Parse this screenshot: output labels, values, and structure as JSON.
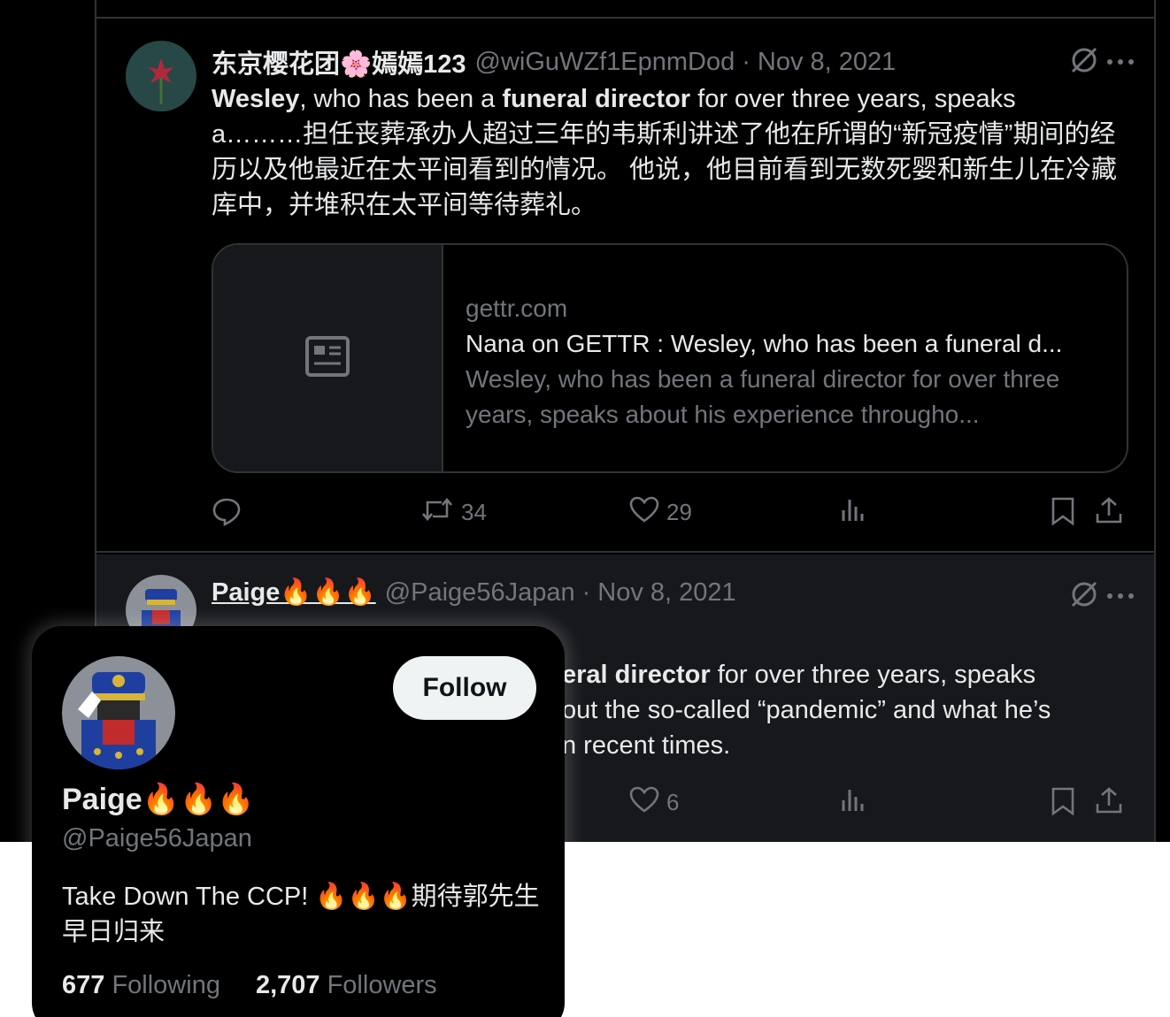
{
  "tweets": [
    {
      "display_name": "东京樱花团🌸嫣嫣123",
      "handle": "@wiGuWZf1EpnmDod",
      "separator": "·",
      "date": "Nov 8, 2021",
      "text_line1_a": "Wesley",
      "text_line1_b": ", who has been a ",
      "text_line1_c": "funeral director",
      "text_line1_d": " for over three years, speaks",
      "text_rest": "a………担任丧葬承办人超过三年的韦斯利讲述了他在所谓的“新冠疫情”期间的经历以及他最近在太平间看到的情况。 他说，他目前看到无数死婴和新生儿在冷藏库中，并堆积在太平间等待葬礼。",
      "card": {
        "domain": "gettr.com",
        "title": "Nana on GETTR : Wesley, who has been a funeral d...",
        "description": "Wesley, who has been a funeral director for over three years, speaks about his experience througho..."
      },
      "actions": {
        "replies": "",
        "reposts": "34",
        "likes": "29"
      }
    },
    {
      "display_name": "Paige🔥🔥🔥",
      "handle": "@Paige56Japan",
      "separator": "·",
      "date": "Nov 8, 2021",
      "text_line1_bold": "eral director",
      "text_line1_rest": " for over three years, speaks",
      "text_line2": "out the so-called “pandemic” and what he’s",
      "text_line3": "n recent times.",
      "actions": {
        "likes": "6"
      }
    }
  ],
  "hover_card": {
    "display_name": "Paige🔥🔥🔥",
    "handle": "@Paige56Japan",
    "follow_label": "Follow",
    "bio": "Take Down The CCP! 🔥🔥🔥期待郭先生早日归来",
    "following_count": "677",
    "following_label": "Following",
    "followers_count": "2,707",
    "followers_label": "Followers"
  },
  "icons": {
    "reply": "reply-icon",
    "repost": "repost-icon",
    "like": "heart-icon",
    "views": "views-icon",
    "bookmark": "bookmark-icon",
    "share": "share-icon",
    "grok": "grok-icon",
    "more": "more-icon",
    "article": "article-icon"
  },
  "colors": {
    "background": "#000000",
    "text": "#e7e9ea",
    "muted": "#71767b",
    "border": "#2f3336",
    "button": "#eff3f4"
  }
}
